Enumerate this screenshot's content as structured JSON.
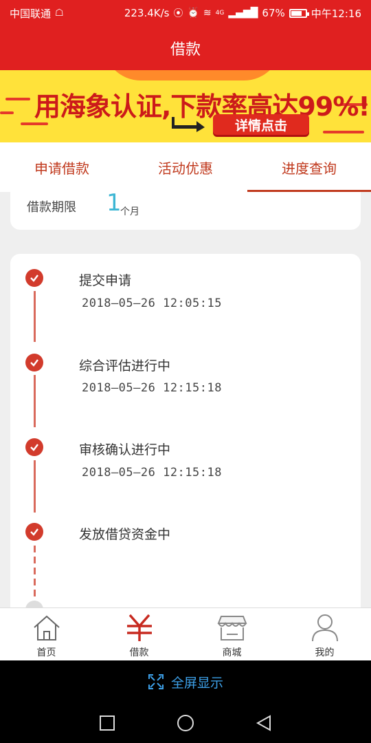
{
  "status_bar": {
    "carrier": "中国联通",
    "speed": "223.4K/s",
    "network": "4G",
    "battery": "67%",
    "time": "中午12:16"
  },
  "header": {
    "title": "借款"
  },
  "banner": {
    "headline": "用海象认证,下款率高达99%!",
    "cta_label": "详情点击"
  },
  "tabs": [
    {
      "label": "申请借款",
      "active": false
    },
    {
      "label": "活动优惠",
      "active": false
    },
    {
      "label": "进度查询",
      "active": true
    }
  ],
  "loan_term": {
    "label": "借款期限",
    "value": "1",
    "unit": "个月"
  },
  "timeline": [
    {
      "title": "提交申请",
      "time": "2018—05—26  12:05:15"
    },
    {
      "title": "综合评估进行中",
      "time": "2018—05—26  12:15:18"
    },
    {
      "title": "审核确认进行中",
      "time": "2018—05—26  12:15:18"
    },
    {
      "title": "发放借贷资金中",
      "time": ""
    }
  ],
  "bottom_nav": [
    {
      "label": "首页",
      "icon": "home-icon",
      "active": false
    },
    {
      "label": "借款",
      "icon": "yen-icon",
      "active": true
    },
    {
      "label": "商城",
      "icon": "store-icon",
      "active": false
    },
    {
      "label": "我的",
      "icon": "person-icon",
      "active": false
    }
  ],
  "fullscreen": {
    "label": "全屏显示"
  },
  "colors": {
    "primary_red": "#e02020",
    "accent_red": "#c0391d",
    "check_red": "#d23b2c",
    "cyan": "#3cb6d4",
    "blue": "#3da0e8"
  }
}
